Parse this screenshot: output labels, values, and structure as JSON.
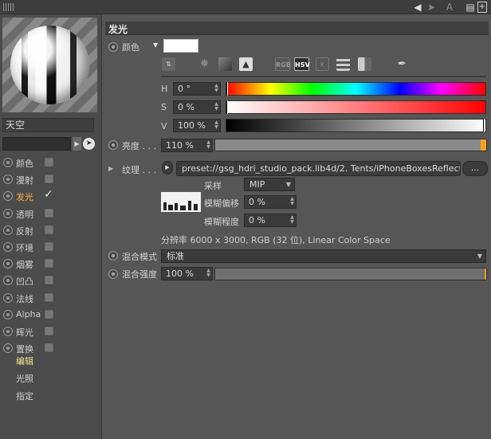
{
  "left_panel": {
    "material_name": "天空",
    "channels": [
      {
        "label": "颜色",
        "enabled": false,
        "active": false
      },
      {
        "label": "漫射",
        "enabled": false,
        "active": false
      },
      {
        "label": "发光",
        "enabled": true,
        "active": true
      },
      {
        "label": "透明",
        "enabled": false,
        "active": false
      },
      {
        "label": "反射",
        "enabled": false,
        "active": false
      },
      {
        "label": "环境",
        "enabled": false,
        "active": false
      },
      {
        "label": "烟雾",
        "enabled": false,
        "active": false
      },
      {
        "label": "凹凸",
        "enabled": false,
        "active": false
      },
      {
        "label": "法线",
        "enabled": false,
        "active": false
      },
      {
        "label": "Alpha",
        "enabled": false,
        "active": false
      },
      {
        "label": "辉光",
        "enabled": false,
        "active": false
      },
      {
        "label": "置换",
        "enabled": false,
        "active": false
      }
    ],
    "tick_glyph": "✓",
    "sub_links": [
      {
        "label": "编辑",
        "color": "#f0e68c"
      },
      {
        "label": "光照",
        "color": "#d0d0d0"
      },
      {
        "label": "指定",
        "color": "#d0d0d0"
      }
    ]
  },
  "top_icons": [
    "back-arrow-icon",
    "pointer-icon",
    "text-icon",
    "lock-icon",
    "new-window-icon"
  ],
  "main": {
    "section_title": "发光",
    "color_label": "颜色",
    "color_value": "#ffffff",
    "color_modes": {
      "rgb": "RGB",
      "hsv": "HSV",
      "kelvin": "K"
    },
    "hsv": {
      "h_label": "H",
      "h_value": "0 °",
      "h_level": 0,
      "s_label": "S",
      "s_value": "0 %",
      "s_level": 0,
      "v_label": "V",
      "v_value": "100 %",
      "v_level": 1
    },
    "brightness_label": "亮度 . . .",
    "brightness_value": "110 %",
    "brightness_level": 1.1,
    "texture_label": "纹理 . . .",
    "texture_path": "preset://gsg_hdri_studio_pack.lib4d/2. Tents/iPhoneBoxesReflecti",
    "texture_more": "...",
    "sampling_label": "采样",
    "sampling_value": "MIP",
    "blur_offset_label": "模糊偏移",
    "blur_offset_value": "0 %",
    "blur_scale_label": "模糊程度",
    "blur_scale_value": "0 %",
    "resolution_info": "分辨率 6000 x 3000, RGB (32 位), Linear Color Space",
    "blend_mode_label": "混合模式",
    "blend_mode_value": "标准",
    "mix_strength_label": "混合强度",
    "mix_strength_value": "100 %",
    "mix_strength_level": 1.0
  },
  "accent_color": "#f0a020"
}
